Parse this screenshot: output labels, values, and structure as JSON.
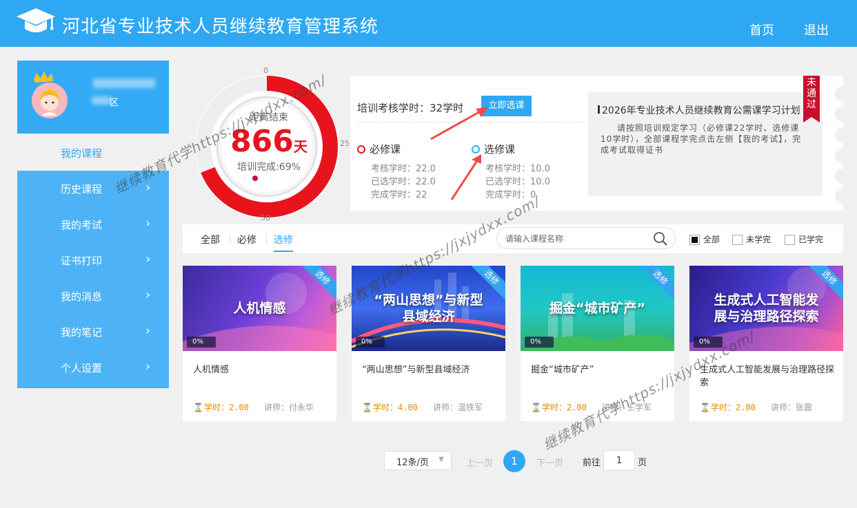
{
  "header": {
    "title": "河北省专业技术人员继续教育管理系统",
    "nav_home": "首页",
    "nav_logout": "退出"
  },
  "profile": {
    "area_suffix": "区"
  },
  "sidebar": {
    "active_item": "我的课程",
    "items": [
      {
        "label": "历史课程"
      },
      {
        "label": "我的考试"
      },
      {
        "label": "证书打印"
      },
      {
        "label": "我的消息"
      },
      {
        "label": "我的笔记"
      },
      {
        "label": "个人设置"
      }
    ],
    "chevron": "›"
  },
  "gauge": {
    "tick_0": "0",
    "tick_25": "25",
    "tick_50": "50",
    "label": "距离结束",
    "days": "866",
    "days_unit": "天",
    "completion": "培训完成:69%",
    "completion_fraction": 0.69,
    "ring_color": "#e7141d"
  },
  "training": {
    "hours_label": "培训考核学时：32学时",
    "select_button": "立即选课",
    "required": {
      "title": "必修课",
      "assess": "考核学时：22.0",
      "selected": "已选学时：22.0",
      "completed": "完成学时：22"
    },
    "elective": {
      "title": "选修课",
      "assess": "考核学时：10.0",
      "selected": "已选学时：10.0",
      "completed": "完成学时：0"
    }
  },
  "notice": {
    "title": "2026年专业技术人员继续教育公需课学习计划",
    "body": "请按照培训规定学习（必修课22学时、选修课10学时），全部课程学完点击左侧【我的考试】，完成考试取得证书",
    "ribbon": "未通过"
  },
  "filter": {
    "tabs": [
      "全部",
      "必修",
      "选修"
    ],
    "active_tab": 2,
    "search_placeholder": "请输入课程名称",
    "checks": [
      {
        "label": "全部",
        "checked": true
      },
      {
        "label": "未学完",
        "checked": false
      },
      {
        "label": "已学完",
        "checked": false
      }
    ]
  },
  "courses": [
    {
      "thumb_title": "人机情感",
      "badge": "选修",
      "progress": "0%",
      "title": "人机情感",
      "hours_prefix": "学时：",
      "hours": "2.00",
      "teacher": "讲师：付永华"
    },
    {
      "thumb_title": "“两山思想”与新型县域经济",
      "badge": "选修",
      "progress": "0%",
      "title": "“两山思想”与新型县域经济",
      "hours_prefix": "学时：",
      "hours": "4.00",
      "teacher": "讲师：温铁军"
    },
    {
      "thumb_title": "掘金“城市矿产”",
      "badge": "选修",
      "progress": "0%",
      "title": "掘金“城市矿产”",
      "hours_prefix": "学时：",
      "hours": "2.00",
      "teacher": "讲师：王学军"
    },
    {
      "thumb_title": "生成式人工智能发展与治理路径探索",
      "badge": "选修",
      "progress": "0%",
      "title": "生成式人工智能发展与治理路径探索",
      "hours_prefix": "学时：",
      "hours": "2.00",
      "teacher": "讲师：张震"
    }
  ],
  "pagination": {
    "page_size": "12条/页",
    "prev": "上一页",
    "current": "1",
    "next": "下一页",
    "goto_label": "前往",
    "goto_value": "1",
    "goto_unit": "页"
  },
  "watermark": "继续教育代学https://jxjydxx.com/",
  "colors": {
    "primary": "#2ea8f3",
    "danger": "#e7141d",
    "warning": "#e88a00"
  }
}
